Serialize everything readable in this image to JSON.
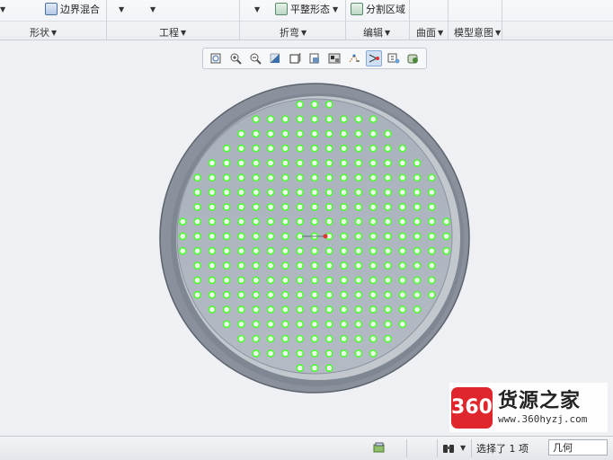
{
  "ribbon": {
    "top_items": {
      "boundary_blend": "边界混合",
      "flatten_form": "平整形态",
      "split_region": "分割区域"
    },
    "groups": {
      "shape": "形状",
      "engineering": "工程",
      "bend": "折弯",
      "edit": "编辑",
      "surfaces": "曲面",
      "model_intent": "模型意图"
    }
  },
  "view_toolbar": {
    "buttons": [
      "refit-icon",
      "zoom-in-icon",
      "zoom-out-icon",
      "repaint-icon",
      "display-style-icon",
      "saved-orientations-icon",
      "view-manager-icon",
      "datum-display-filter-icon",
      "annotation-display-icon",
      "spin-center-icon",
      "perspective-icon"
    ],
    "active": "annotation-display-icon"
  },
  "status": {
    "selection": "选择了 1 项",
    "filter": "几何"
  },
  "watermark": {
    "logo": "360",
    "name": "货源之家",
    "url": "www.360hyzj.com"
  },
  "colors": {
    "background": "#eef0f4",
    "plate_face": "#aeb5bf",
    "rim": "#7f8793",
    "hole_point": "#4cff2f",
    "logo_red": "#e0262d"
  }
}
